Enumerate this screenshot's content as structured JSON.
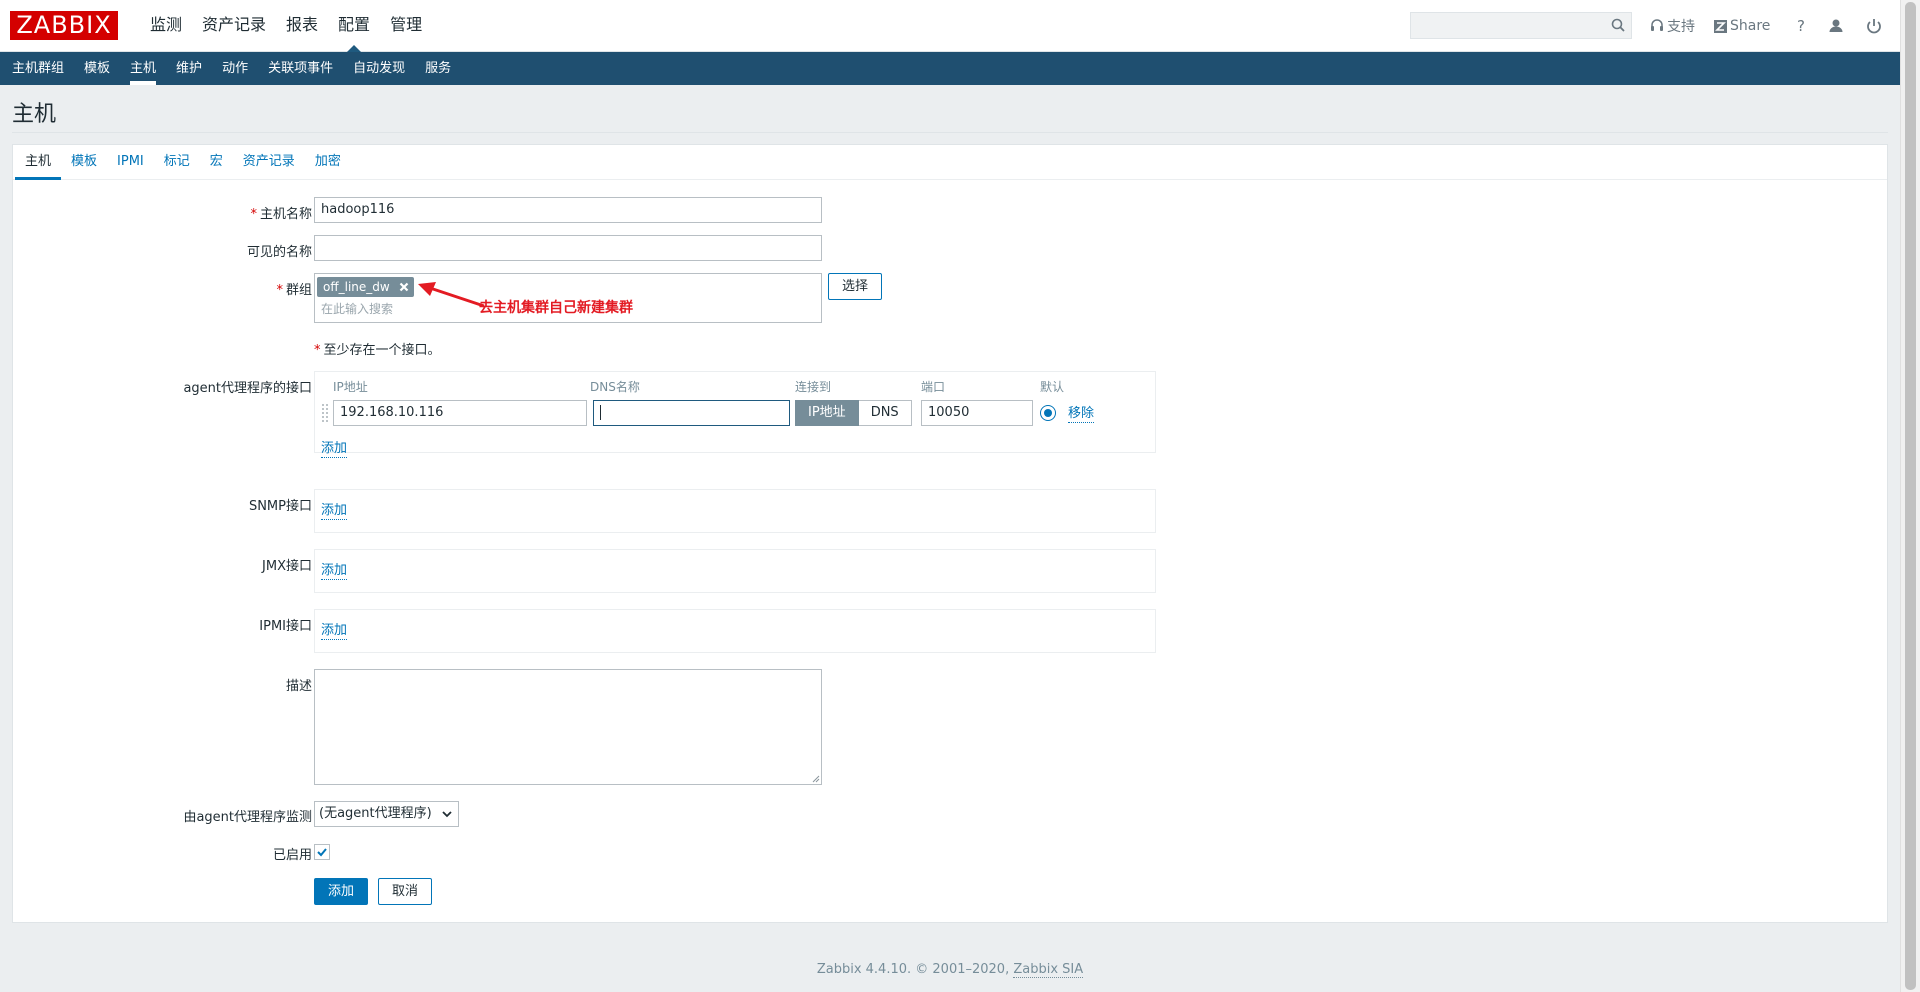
{
  "header": {
    "logo": "ZABBIX",
    "main_menu": [
      "监测",
      "资产记录",
      "报表",
      "配置",
      "管理"
    ],
    "active_main": "配置",
    "search_value": "",
    "support_label": "支持",
    "share_label": "Share",
    "help_label": "?"
  },
  "submenu": [
    "主机群组",
    "模板",
    "主机",
    "维护",
    "动作",
    "关联项事件",
    "自动发现",
    "服务"
  ],
  "page_title": "主机",
  "tabs": [
    "主机",
    "模板",
    "IPMI",
    "标记",
    "宏",
    "资产记录",
    "加密"
  ],
  "form": {
    "host_name_label": "主机名称",
    "host_name_value": "hadoop116",
    "visible_name_label": "可见的名称",
    "visible_name_value": "",
    "groups_label": "群组",
    "group_chip": "off_line_dw",
    "groups_placeholder": "在此输入搜索",
    "select_button": "选择",
    "annotation": "去主机集群自己新建集群",
    "interface_note": "至少存在一个接口。",
    "agent_label": "agent代理程序的接口",
    "columns": [
      "IP地址",
      "DNS名称",
      "连接到",
      "端口",
      "默认"
    ],
    "ip_value": "192.168.10.116",
    "dns_value": "",
    "connect_ip": "IP地址",
    "connect_dns": "DNS",
    "port_value": "10050",
    "remove_link": "移除",
    "add_link": "添加",
    "snmp_label": "SNMP接口",
    "jmx_label": "JMX接口",
    "ipmi_label": "IPMI接口",
    "description_label": "描述",
    "proxy_label": "由agent代理程序监测",
    "proxy_value": "(无agent代理程序)",
    "enabled_label": "已启用",
    "enabled": true,
    "submit_button": "添加",
    "cancel_button": "取消"
  },
  "footer": {
    "text": "Zabbix 4.4.10. © 2001–2020,",
    "link": "Zabbix SIA"
  },
  "colors": {
    "brand_red": "#d40000",
    "nav_blue": "#1f4f70",
    "link_blue": "#0275b8",
    "annotation_red": "#e31b23"
  }
}
